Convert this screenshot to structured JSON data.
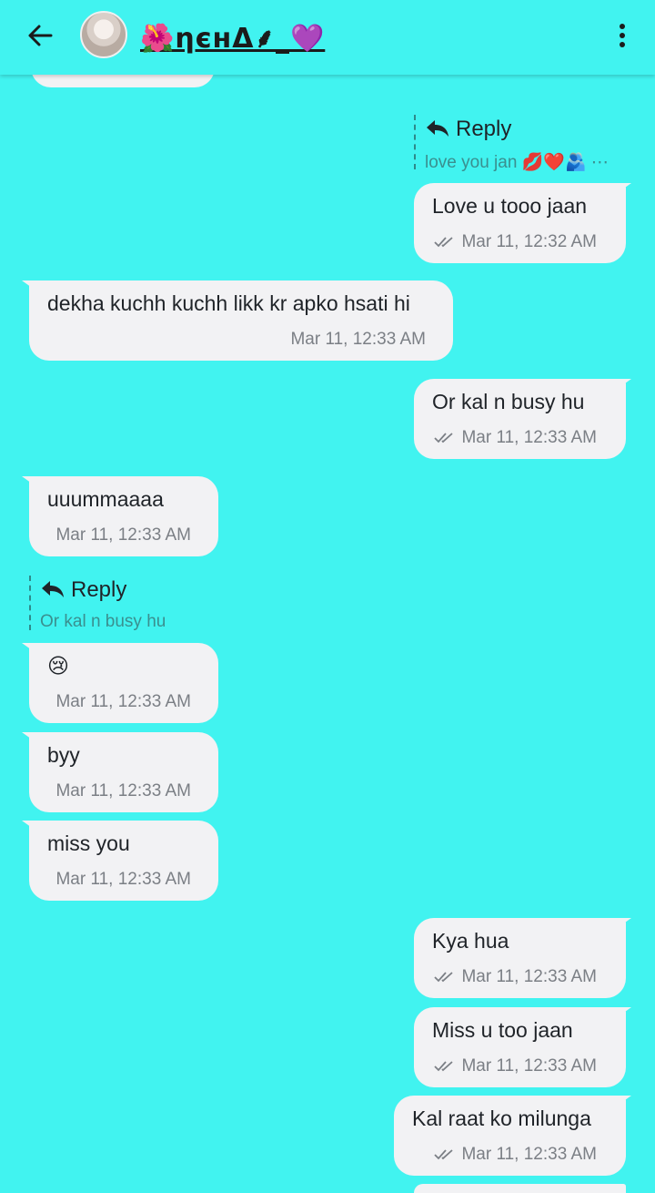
{
  "header": {
    "title": "🌺ηєнΔ⸙_💜",
    "back_icon": "arrow-left-icon",
    "menu_icon": "more-vertical-icon"
  },
  "messages": [
    {
      "direction": "in",
      "text": "",
      "time": ""
    },
    {
      "direction": "out",
      "reply_label": "Reply",
      "reply_quote": "love you jan 💋❤️🫂 ⋯",
      "text": "Love u tooo jaan",
      "time": "Mar 11, 12:32 AM"
    },
    {
      "direction": "in",
      "text": "dekha kuchh kuchh likk kr apko hsati hi",
      "time": "Mar 11, 12:33 AM"
    },
    {
      "direction": "out",
      "text": "Or kal n busy hu",
      "time": "Mar 11, 12:33 AM"
    },
    {
      "direction": "in",
      "text": "uuummaaaa",
      "time": "Mar 11, 12:33 AM"
    },
    {
      "direction": "in",
      "reply_label": "Reply",
      "reply_quote": "Or kal n busy hu",
      "text": "😢",
      "time": "Mar 11, 12:33 AM"
    },
    {
      "direction": "in",
      "text": "byy",
      "time": "Mar 11, 12:33 AM"
    },
    {
      "direction": "in",
      "text": "miss you",
      "time": "Mar 11, 12:33 AM"
    },
    {
      "direction": "out",
      "text": "Kya hua",
      "time": "Mar 11, 12:33 AM"
    },
    {
      "direction": "out",
      "text": "Miss u too jaan",
      "time": "Mar 11, 12:33 AM"
    },
    {
      "direction": "out",
      "text": "Kal raat ko milunga",
      "time": "Mar 11, 12:33 AM"
    }
  ],
  "colors": {
    "background": "#41F3F0",
    "bubble": "#F2F2F4",
    "timestamp": "#7b7f85",
    "reply_quote": "#3a8f8f"
  }
}
